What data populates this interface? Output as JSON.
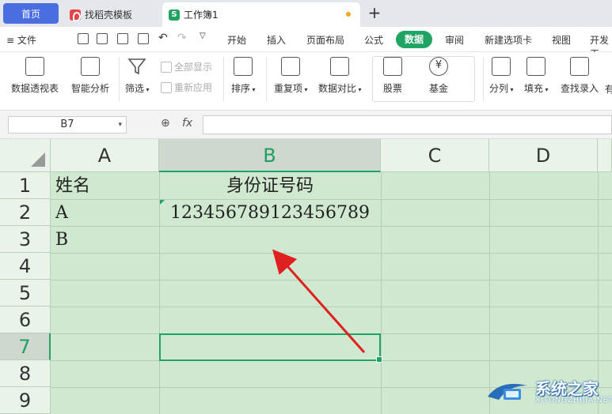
{
  "tabs": {
    "home": "首页",
    "template": "找稻壳模板",
    "document": "工作簿1",
    "add": "+"
  },
  "menubar": {
    "file": "≡ 文件",
    "items": [
      "开始",
      "插入",
      "页面布局",
      "公式",
      "审阅",
      "新建选项卡",
      "视图",
      "开发工"
    ],
    "active": "数据"
  },
  "ribbon": {
    "pivot": "数据透视表",
    "smart": "智能分析",
    "filter": "筛选",
    "show_all": "全部显示",
    "reapply": "重新应用",
    "sort": "排序",
    "duplicates": "重复项",
    "compare": "数据对比",
    "stock": "股票",
    "fund": "基金",
    "split": "分列",
    "fill": "填充",
    "lookup": "查找录入",
    "more": "有"
  },
  "formula_bar": {
    "name_box": "B7",
    "fx": "fx",
    "formula": ""
  },
  "sheet": {
    "columns": [
      "A",
      "B",
      "C",
      "D"
    ],
    "rows": [
      "1",
      "2",
      "3",
      "4",
      "5",
      "6",
      "7",
      "8",
      "9"
    ],
    "cells": {
      "A1": "姓名",
      "B1": "身份证号码",
      "A2": "A",
      "B2": "123456789123456789",
      "A3": "B"
    },
    "selected_cell": "B7"
  },
  "watermark": {
    "title": "系统之家",
    "sub": "XITONGZHIJIA.NET"
  },
  "colors": {
    "accent": "#1fa463",
    "sheet_bg": "#cfe8cf",
    "arrow": "#e02020"
  }
}
